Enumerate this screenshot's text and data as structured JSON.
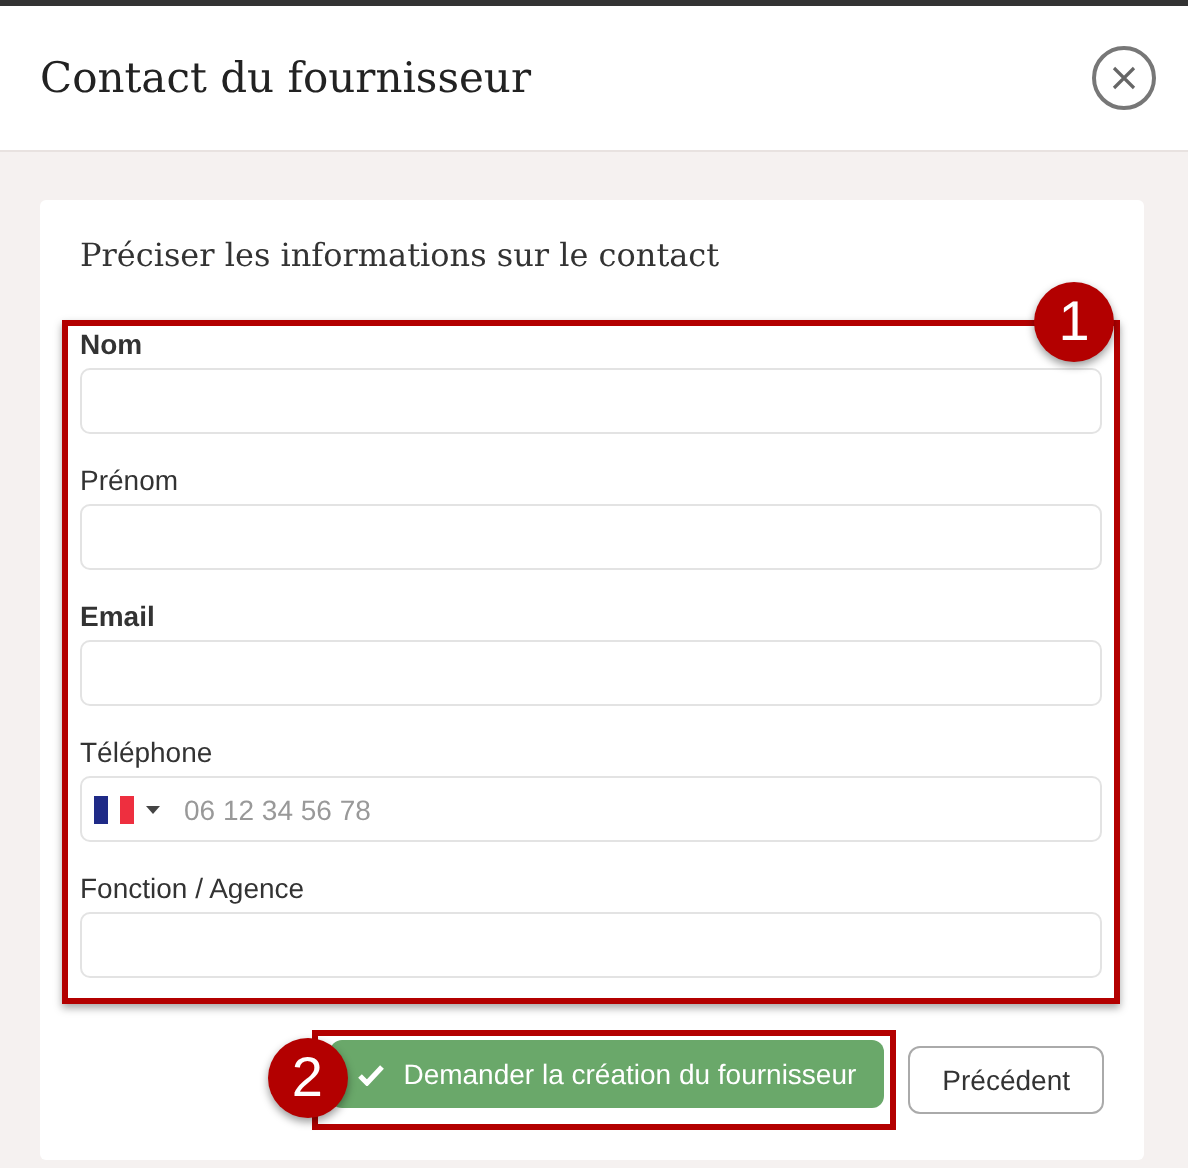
{
  "dialog": {
    "title": "Contact du fournisseur"
  },
  "section": {
    "heading": "Préciser les informations sur le contact"
  },
  "fields": [
    {
      "kind": "text",
      "label": "Nom",
      "required": true
    },
    {
      "kind": "text",
      "label": "Prénom",
      "required": false
    },
    {
      "kind": "text",
      "label": "Email",
      "required": true
    },
    {
      "kind": "phone",
      "label": "Téléphone",
      "required": false,
      "placeholder": "06 12 34 56 78"
    },
    {
      "kind": "text",
      "label": "Fonction / Agence",
      "required": false
    }
  ],
  "annotations": [
    {
      "number": "1"
    },
    {
      "number": "2"
    }
  ],
  "buttons": [
    {
      "kind": "primary",
      "label": "Demander la création du fournisseur"
    },
    {
      "kind": "secondary",
      "label": "Précédent"
    }
  ]
}
